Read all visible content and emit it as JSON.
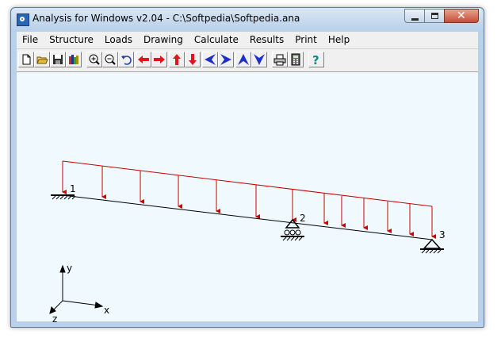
{
  "window": {
    "title": "Analysis for Windows v2.04 - C:\\Softpedia\\Softpedia.ana"
  },
  "menu": [
    "File",
    "Structure",
    "Loads",
    "Drawing",
    "Calculate",
    "Results",
    "Print",
    "Help"
  ],
  "toolbar": {
    "buttons": [
      {
        "name": "new-file-button",
        "icon": "new-file-icon"
      },
      {
        "name": "open-button",
        "icon": "open-folder-icon"
      },
      {
        "name": "save-button",
        "icon": "floppy-disk-icon"
      },
      {
        "name": "library-button",
        "icon": "books-icon"
      },
      {
        "name": "zoom-in-button",
        "icon": "zoom-in-icon"
      },
      {
        "name": "zoom-out-button",
        "icon": "zoom-out-icon"
      },
      {
        "name": "undo-button",
        "icon": "undo-arrow-icon"
      },
      {
        "name": "move-left-button",
        "icon": "red-arrow-left-icon"
      },
      {
        "name": "move-right-button",
        "icon": "red-arrow-right-icon"
      },
      {
        "name": "move-up-button",
        "icon": "red-arrow-up-icon"
      },
      {
        "name": "move-down-button",
        "icon": "red-arrow-down-icon"
      },
      {
        "name": "rotate-left-button",
        "icon": "blue-arrow-left-icon"
      },
      {
        "name": "rotate-right-button",
        "icon": "blue-arrow-right-icon"
      },
      {
        "name": "rotate-up-button",
        "icon": "blue-arrow-up-icon"
      },
      {
        "name": "rotate-down-button",
        "icon": "blue-arrow-down-icon"
      },
      {
        "name": "print-button",
        "icon": "printer-icon"
      },
      {
        "name": "calculator-button",
        "icon": "calculator-icon"
      },
      {
        "name": "help-button",
        "icon": "help-question-icon"
      }
    ]
  },
  "drawing": {
    "nodes": [
      {
        "label": "1",
        "support": "fixed"
      },
      {
        "label": "2",
        "support": "roller"
      },
      {
        "label": "3",
        "support": "pin"
      }
    ],
    "axes": {
      "y": "y",
      "x": "x",
      "z": "z"
    },
    "colors": {
      "beam": "#000000",
      "load": "#cc0000",
      "background": "#f0fafe"
    }
  }
}
